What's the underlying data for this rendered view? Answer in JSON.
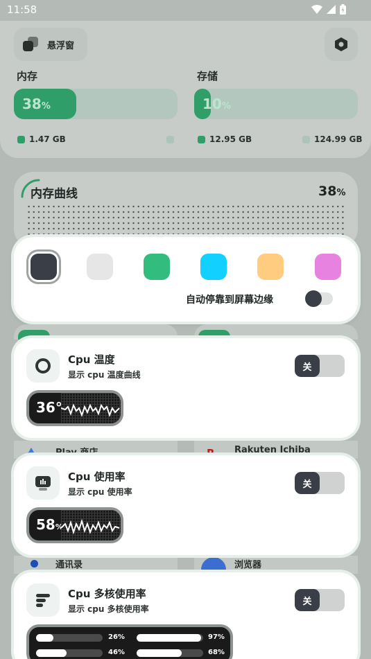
{
  "status_bar": {
    "time": "11:58"
  },
  "header": {
    "floating_window_label": "悬浮窗"
  },
  "memory": {
    "title": "内存",
    "percent": "38",
    "percent_unit": "%",
    "used": "1.47 GB",
    "used_fraction": 0.38
  },
  "storage": {
    "title": "存储",
    "percent": "10",
    "percent_unit": "%",
    "used": "12.95 GB",
    "total": "124.99 GB",
    "used_fraction": 0.1
  },
  "memory_curve": {
    "title": "内存曲线",
    "value": "38",
    "unit": "%"
  },
  "color_picker": {
    "colors": [
      "#3a3f47",
      "#e6e6e6",
      "#32bd7f",
      "#12d0ff",
      "#ffcc80",
      "#e882e0"
    ],
    "selected_index": 0,
    "auto_dock_label": "自动停靠到屏幕边缘",
    "auto_dock_on": false
  },
  "background_apps": {
    "play_store": "Play 商店",
    "rakuten": "Rakuten Ichiba",
    "contacts": "通讯录",
    "browser": "浏览器"
  },
  "features": {
    "cpu_temp": {
      "title": "Cpu 温度",
      "subtitle": "显示 cpu 温度曲线",
      "switch_label": "关",
      "preview_value": "36°"
    },
    "cpu_usage": {
      "title": "Cpu 使用率",
      "subtitle": "显示 cpu 使用率",
      "switch_label": "关",
      "preview_value": "58",
      "preview_unit": "%"
    },
    "cpu_multicore": {
      "title": "Cpu 多核使用率",
      "subtitle": "显示 cpu 多核使用率",
      "switch_label": "关",
      "cores": [
        {
          "label": "26%",
          "fraction": 0.26
        },
        {
          "label": "97%",
          "fraction": 0.97
        },
        {
          "label": "46%",
          "fraction": 0.46
        },
        {
          "label": "68%",
          "fraction": 0.68
        }
      ]
    }
  },
  "colors": {
    "accent_green": "#2f9e68",
    "dark": "#3a3f47",
    "card": "#ffffff",
    "dim_background": "#b4bbb6"
  }
}
